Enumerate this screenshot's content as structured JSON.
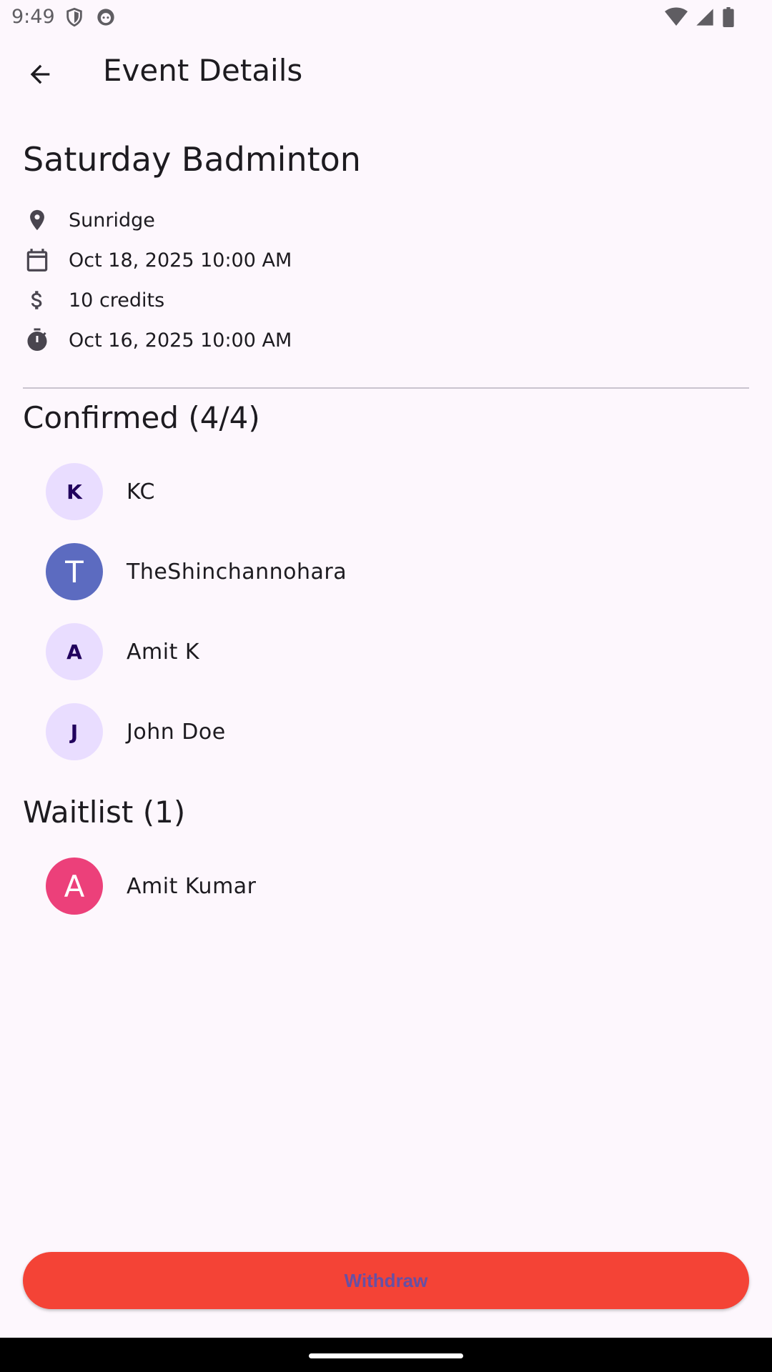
{
  "status_bar": {
    "time": "9:49",
    "left_icons": [
      "shield-icon",
      "face-icon"
    ],
    "right_icons": [
      "wifi-icon",
      "cell-signal-icon",
      "battery-icon"
    ]
  },
  "app_bar": {
    "back_icon": "arrow-back-icon",
    "title": "Event Details"
  },
  "event": {
    "title": "Saturday Badminton",
    "location": "Sunridge",
    "date": "Oct 18, 2025 10:00 AM",
    "cost": "10 credits",
    "deadline": "Oct 16, 2025 10:00 AM"
  },
  "confirmed": {
    "title": "Confirmed (4/4)",
    "people": [
      {
        "initial": "K",
        "name": "KC",
        "avatar_color": "#e9ddff"
      },
      {
        "initial": "T",
        "name": "TheShinchannohara",
        "avatar_color": "#5c6bc0"
      },
      {
        "initial": "A",
        "name": "Amit K",
        "avatar_color": "#e9ddff"
      },
      {
        "initial": "J",
        "name": "John Doe",
        "avatar_color": "#e9ddff"
      }
    ]
  },
  "waitlist": {
    "title": "Waitlist (1)",
    "people": [
      {
        "initial": "A",
        "name": "Amit Kumar",
        "avatar_color": "#ec407a"
      }
    ]
  },
  "actions": {
    "withdraw_label": "Withdraw",
    "withdraw_color": "#f44336",
    "withdraw_text_color": "#6750a4"
  }
}
